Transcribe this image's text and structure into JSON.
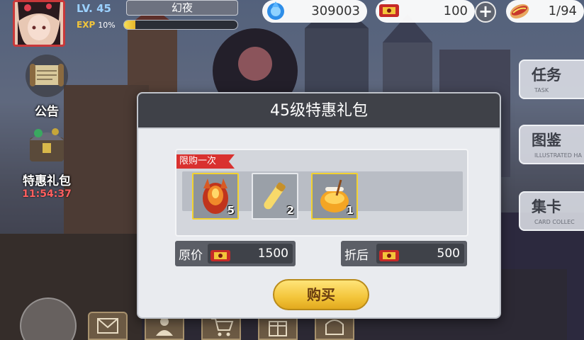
{
  "player": {
    "level_label": "LV. 45",
    "name": "幻夜",
    "exp_label": "EXP",
    "exp_pct": "10%",
    "exp_fraction": 0.1
  },
  "resources": {
    "crystal": "309003",
    "ticket": "100",
    "food": "1/94"
  },
  "left_menu": {
    "notice": "公告",
    "gift": "特惠礼包",
    "timer": "11:54:37"
  },
  "right_menu": [
    {
      "title": "任务",
      "sub": "TASK"
    },
    {
      "title": "图鉴",
      "sub": "ILLUSTRATED HA"
    },
    {
      "title": "集卡",
      "sub": "CARD COLLEC"
    }
  ],
  "dialog": {
    "title": "45级特惠礼包",
    "limit_tag": "限购一次",
    "items": [
      {
        "icon": "dragon-egg-icon",
        "count": "5"
      },
      {
        "icon": "potion-vial-icon",
        "count": "2"
      },
      {
        "icon": "honey-jar-icon",
        "count": "1"
      }
    ],
    "original_label": "原价",
    "original_price": "1500",
    "discount_label": "折后",
    "discount_price": "500",
    "buy_label": "购买"
  },
  "colors": {
    "dialog_header": "#3f4148",
    "ribbon": "#d9312f",
    "buy_button": "#f3c53a",
    "item_border": "#f2d230"
  }
}
